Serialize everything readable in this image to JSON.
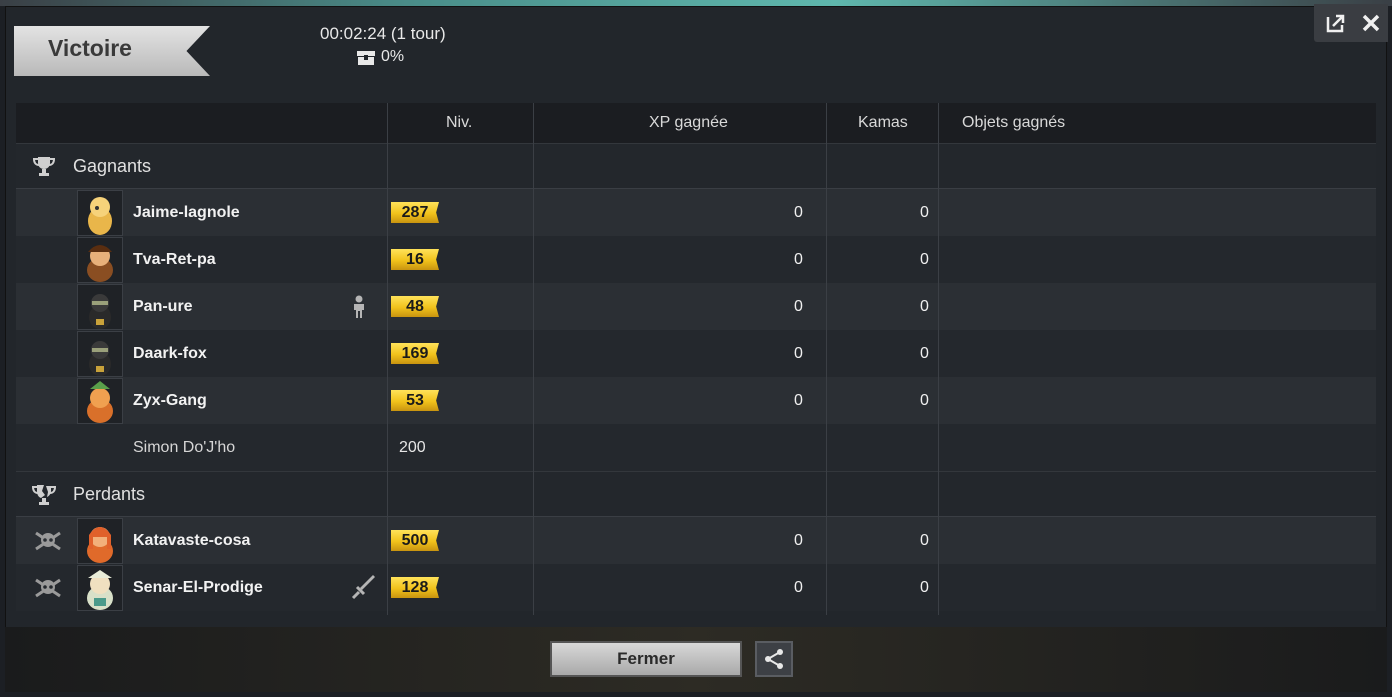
{
  "result_title": "Victoire",
  "duration": "00:02:24 (1 tour)",
  "chest_percent": "0%",
  "columns": {
    "level": "Niv.",
    "xp": "XP gagnée",
    "kamas": "Kamas",
    "items": "Objets gagnés"
  },
  "winners": {
    "label": "Gagnants",
    "players": [
      {
        "name": "Jaime-lagnole",
        "level": "287",
        "xp": "0",
        "kamas": "0"
      },
      {
        "name": "Tva-Ret-pa",
        "level": "16",
        "xp": "0",
        "kamas": "0"
      },
      {
        "name": "Pan-ure",
        "level": "48",
        "xp": "0",
        "kamas": "0"
      },
      {
        "name": "Daark-fox",
        "level": "169",
        "xp": "0",
        "kamas": "0"
      },
      {
        "name": "Zyx-Gang",
        "level": "53",
        "xp": "0",
        "kamas": "0"
      }
    ],
    "companion": {
      "name": "Simon Do'J'ho",
      "level": "200"
    }
  },
  "losers": {
    "label": "Perdants",
    "players": [
      {
        "name": "Katavaste-cosa",
        "level": "500",
        "xp": "0",
        "kamas": "0"
      },
      {
        "name": "Senar-El-Prodige",
        "level": "128",
        "xp": "0",
        "kamas": "0"
      }
    ]
  },
  "buttons": {
    "close": "Fermer"
  },
  "colors": {
    "level_badge": "#f1c21b",
    "panel_bg": "#22262b"
  }
}
